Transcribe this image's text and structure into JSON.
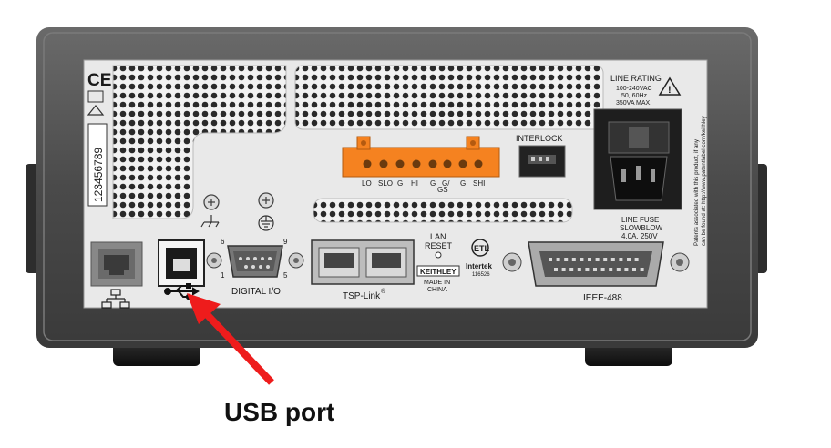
{
  "panel": {
    "serial_label": "123456789",
    "line_rating_title": "LINE RATING",
    "line_rating_voltage": "100-240VAC",
    "line_rating_freq": "50, 60Hz",
    "line_rating_power": "350VA MAX.",
    "interlock_label": "INTERLOCK",
    "terminal_labels": [
      "LO",
      "SLO",
      "G",
      "HI",
      "G",
      "G/",
      "G",
      "SHI"
    ],
    "terminal_gs_label": "GS",
    "line_fuse_title": "LINE FUSE",
    "line_fuse_type": "SLOWBLOW",
    "line_fuse_rating": "4.0A, 250V",
    "patents_line1": "Patents associated with this product, if any",
    "patents_line2": "can be found at: http://www.patentlabel.com/keithley",
    "digital_io_label": "DIGITAL I/O",
    "digital_io_pins": [
      "6",
      "9",
      "1",
      "5"
    ],
    "tsp_link_label": "TSP-Link",
    "registered_mark": "®",
    "lan_reset_line1": "LAN",
    "lan_reset_line2": "RESET",
    "brand_badge": "KEITHLEY",
    "made_in_line1": "MADE IN",
    "made_in_line2": "CHINA",
    "intertek_label": "Intertek",
    "intertek_number": "116526",
    "ieee_label": "IEEE-488"
  },
  "callout": {
    "caption": "USB port",
    "arrow_color": "#ee1c1c"
  },
  "colors": {
    "chassis": "#4a4a4a",
    "panel": "#e8e8e8",
    "terminal_block": "#f58220"
  }
}
